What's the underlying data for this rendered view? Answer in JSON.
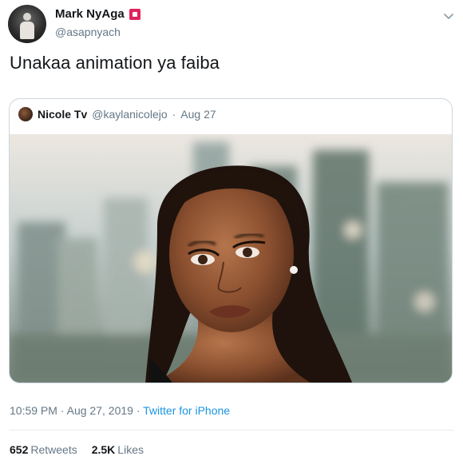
{
  "author": {
    "display_name": "Mark NyAga",
    "handle": "@asapnyach"
  },
  "tweet": {
    "text": "Unakaa animation ya faiba"
  },
  "quoted": {
    "display_name": "Nicole Tv",
    "handle": "@kaylanicolejo",
    "separator": "·",
    "date": "Aug 27"
  },
  "meta": {
    "time": "10:59 PM",
    "separator1": "·",
    "date": "Aug 27, 2019",
    "separator2": "·",
    "source": "Twitter for iPhone"
  },
  "stats": {
    "retweets_count": "652",
    "retweets_label": "Retweets",
    "likes_count": "2.5K",
    "likes_label": "Likes"
  },
  "icons": {
    "caret": "chevron-down-icon",
    "badge": "verified-badge-icon"
  },
  "colors": {
    "link": "#1b95e0",
    "muted": "#657786",
    "badge": "#e0245e"
  }
}
